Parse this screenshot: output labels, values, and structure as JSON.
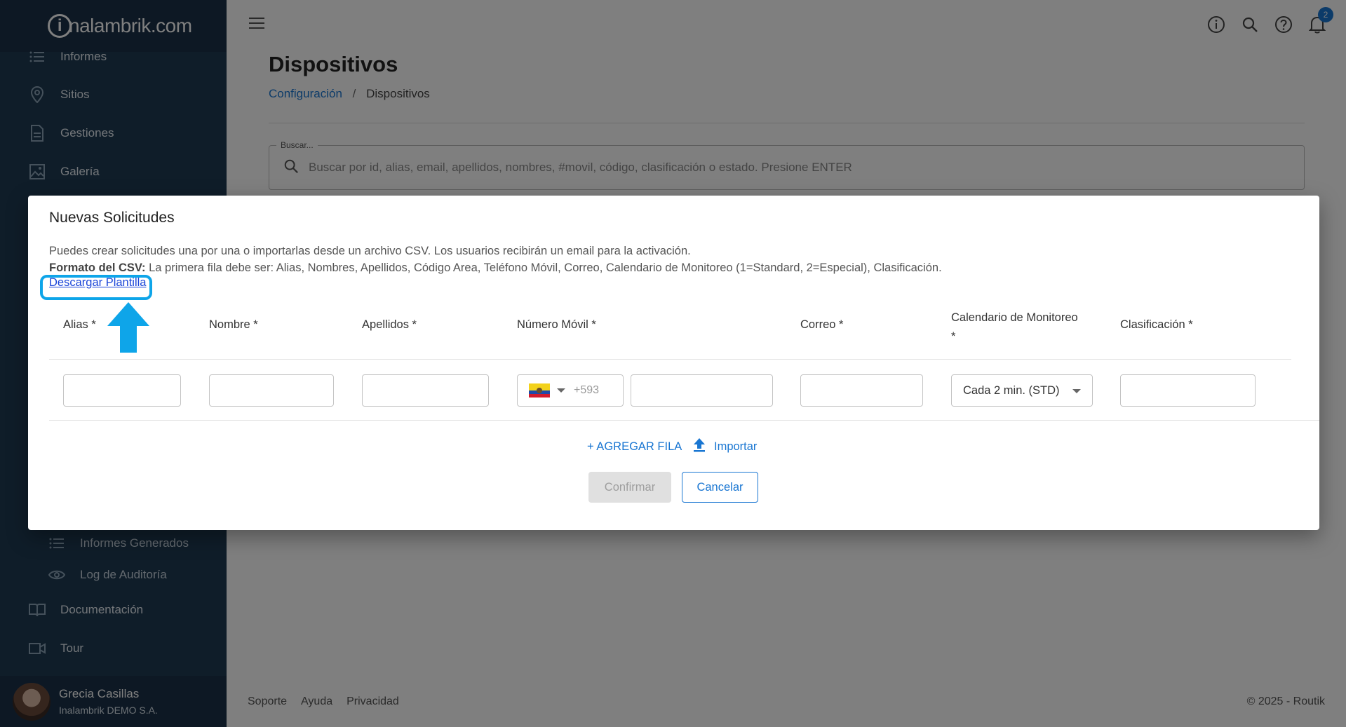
{
  "sidebar": {
    "logo_text": "nalambrik.com",
    "logo_mark": "i",
    "items": [
      {
        "label": "Informes",
        "icon": "list-icon"
      },
      {
        "label": "Sitios",
        "icon": "location-pin-icon"
      },
      {
        "label": "Gestiones",
        "icon": "document-icon"
      },
      {
        "label": "Galería",
        "icon": "image-icon"
      }
    ],
    "sub_items": [
      {
        "label": "Informes Generados",
        "icon": "list-icon"
      },
      {
        "label": "Log de Auditoría",
        "icon": "eye-icon"
      }
    ],
    "bottom_items": [
      {
        "label": "Documentación",
        "icon": "book-icon"
      },
      {
        "label": "Tour",
        "icon": "video-camera-icon"
      }
    ],
    "user": {
      "name": "Grecia Casillas",
      "org": "Inalambrik DEMO S.A."
    }
  },
  "topbar": {
    "notification_count": "2"
  },
  "page": {
    "title": "Dispositivos",
    "breadcrumb": {
      "parent": "Configuración",
      "separator": "/",
      "current": "Dispositivos"
    },
    "search": {
      "legend": "Buscar...",
      "placeholder": "Buscar por id, alias, email, apellidos, nombres, #movil, código, clasificación o estado. Presione ENTER"
    }
  },
  "footer": {
    "links": [
      "Soporte",
      "Ayuda",
      "Privacidad"
    ],
    "copyright": "© 2025 - Routik"
  },
  "dialog": {
    "title": "Nuevas Solicitudes",
    "intro": "Puedes crear solicitudes una por una o importarlas desde un archivo CSV. Los usuarios recibirán un email para la activación.",
    "format_label": "Formato del CSV:",
    "format_text": " La primera fila debe ser: Alias, Nombres, Apellidos, Código Area, Teléfono Móvil, Correo, Calendario de Monitoreo (1=Standard, 2=Especial), Clasificación.",
    "template_link": "Descargar Plantilla",
    "columns": {
      "alias": "Alias *",
      "nombre": "Nombre *",
      "apellidos": "Apellidos *",
      "movil": "Número Móvil *",
      "correo": "Correo *",
      "calendario": "Calendario de Monitoreo",
      "calendario_req": "*",
      "clasificacion": "Clasificación *"
    },
    "row": {
      "phone_prefix": "+593",
      "calendar_value": "Cada 2 min. (STD)"
    },
    "add_row": "+ AGREGAR FILA",
    "import": "Importar",
    "confirm": "Confirmar",
    "cancel": "Cancelar"
  }
}
